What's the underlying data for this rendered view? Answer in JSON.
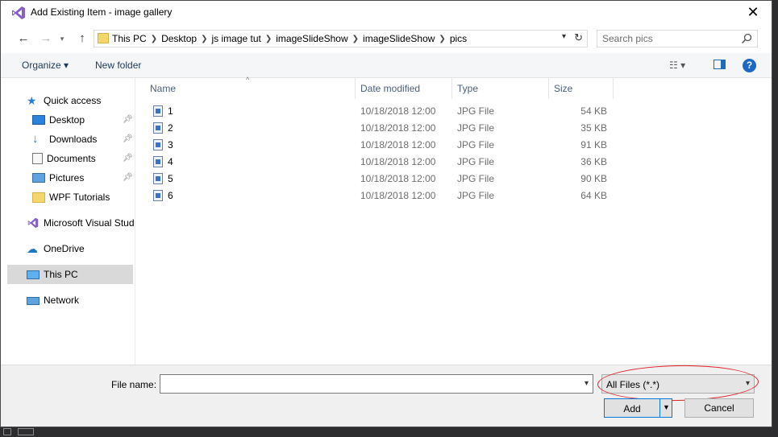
{
  "window": {
    "title": "Add Existing Item - image gallery",
    "close_glyph": "✕"
  },
  "address": {
    "crumbs": [
      "This PC",
      "Desktop",
      "js image tut",
      "imageSlideShow",
      "imageSlideShow",
      "pics"
    ],
    "search_placeholder": "Search pics"
  },
  "toolbar": {
    "organize_label": "Organize ▾",
    "new_folder_label": "New folder",
    "view_glyph": "☷ ▾",
    "help_glyph": "?"
  },
  "nav": {
    "quick_access": "Quick access",
    "desktop": "Desktop",
    "downloads": "Downloads",
    "documents": "Documents",
    "pictures": "Pictures",
    "wpf_tutorials": "WPF Tutorials",
    "visual_studio": "Microsoft Visual Studio",
    "onedrive": "OneDrive",
    "this_pc": "This PC",
    "network": "Network"
  },
  "columns": {
    "name": "Name",
    "date": "Date modified",
    "type": "Type",
    "size": "Size"
  },
  "files": [
    {
      "name": "1",
      "date": "10/18/2018 12:00",
      "type": "JPG File",
      "size": "54 KB"
    },
    {
      "name": "2",
      "date": "10/18/2018 12:00",
      "type": "JPG File",
      "size": "35 KB"
    },
    {
      "name": "3",
      "date": "10/18/2018 12:00",
      "type": "JPG File",
      "size": "91 KB"
    },
    {
      "name": "4",
      "date": "10/18/2018 12:00",
      "type": "JPG File",
      "size": "36 KB"
    },
    {
      "name": "5",
      "date": "10/18/2018 12:00",
      "type": "JPG File",
      "size": "90 KB"
    },
    {
      "name": "6",
      "date": "10/18/2018 12:00",
      "type": "JPG File",
      "size": "64 KB"
    }
  ],
  "bottom": {
    "file_name_label": "File name:",
    "file_name_value": "",
    "filter_value": "All Files (*.*)",
    "add_label": "Add",
    "cancel_label": "Cancel"
  },
  "colors": {
    "accent": "#0078d7",
    "vs_purple": "#865fc5",
    "annotation_red": "#e0202a"
  }
}
